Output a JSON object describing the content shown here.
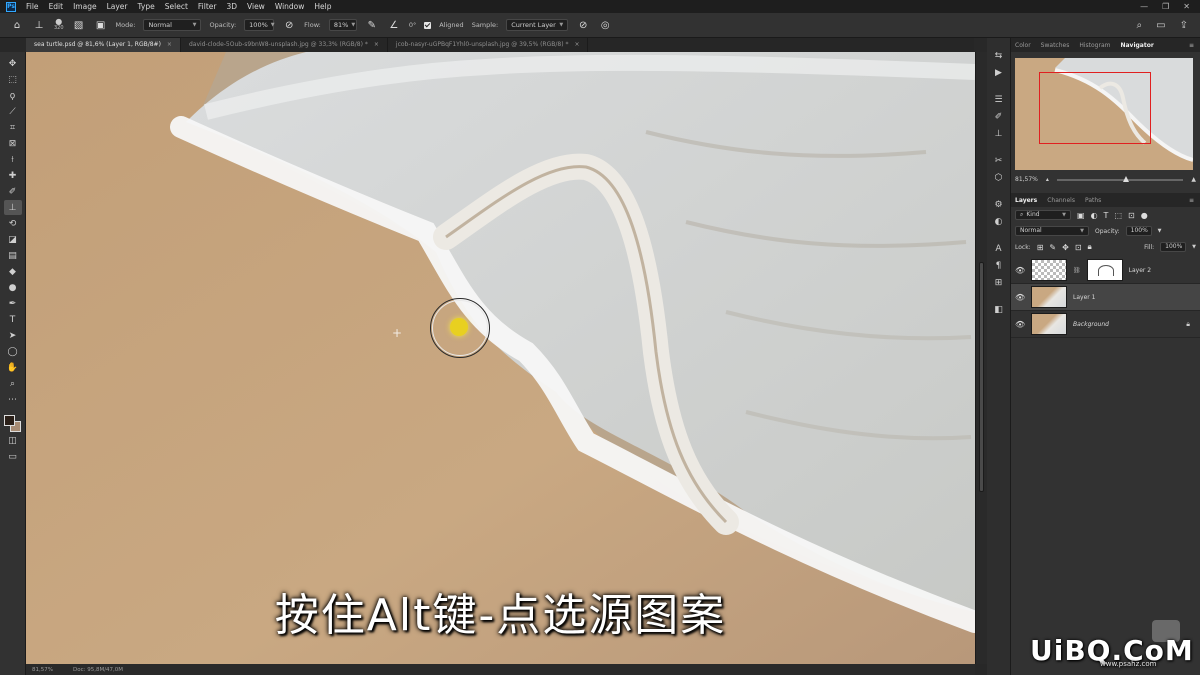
{
  "app": {
    "logo": "Ps"
  },
  "menu": [
    "File",
    "Edit",
    "Image",
    "Layer",
    "Type",
    "Select",
    "Filter",
    "3D",
    "View",
    "Window",
    "Help"
  ],
  "window_controls": [
    "—",
    "❐",
    "✕"
  ],
  "options": {
    "brush_size": "320",
    "mode_label": "Mode:",
    "mode_value": "Normal",
    "opacity_label": "Opacity:",
    "opacity_value": "100%",
    "flow_label": "Flow:",
    "flow_value": "81%",
    "angle_value": "0°",
    "aligned_label": "Aligned",
    "sample_label": "Sample:",
    "sample_value": "Current Layer"
  },
  "tabs": [
    {
      "label": "sea turtle.psd @ 81,6% (Layer 1, RGB/8#)",
      "active": true
    },
    {
      "label": "david-clode-5Oub-s9bnW8-unsplash.jpg @ 33,3% (RGB/8) *",
      "active": false
    },
    {
      "label": "jcob-nasyr-uGPBqF1Yhl0-unsplash.jpg @ 39,5% (RGB/8) *",
      "active": false
    }
  ],
  "canvas": {
    "caption": "按住Alt键-点选源图案",
    "crosshair": "+"
  },
  "status": {
    "zoom": "81,57%",
    "doc": "Doc: 95,8M/47,0M"
  },
  "panels": {
    "top_tabs": [
      "Color",
      "Swatches",
      "Histogram",
      "Navigator"
    ],
    "active_top_tab": "Navigator",
    "nav_zoom": "81,57%",
    "layer_tabs": [
      "Layers",
      "Channels",
      "Paths"
    ],
    "filter_kind": "Kind",
    "blend_mode": "Normal",
    "opacity_label": "Opacity:",
    "opacity_value": "100%",
    "lock_label": "Lock:",
    "fill_label": "Fill:",
    "fill_value": "100%",
    "layers": [
      {
        "name": "Layer 2",
        "type": "masked"
      },
      {
        "name": "Layer 1",
        "type": "photo",
        "selected": true
      },
      {
        "name": "Background",
        "type": "photo",
        "locked": true
      }
    ]
  },
  "watermark": {
    "main": "UiBQ.CoM",
    "sub": "www.psahz.com"
  },
  "colors": {
    "foreground": "#2a1f18",
    "background": "#a88c74",
    "nav_rect": "#e02020",
    "cursor_dot": "#e8d020"
  }
}
